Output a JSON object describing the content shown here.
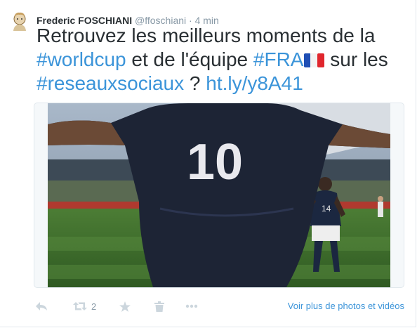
{
  "tweet": {
    "author_name": "Frederic FOSCHIANI",
    "handle": "@ffoschiani",
    "separator": "·",
    "time": "4 min",
    "text_part1": "Retrouvez les meilleurs moments de la ",
    "hashtag_worldcup": "#worldcup",
    "text_part2": " et de l'équipe ",
    "hashtag_fra": "#FRA",
    "text_part3": " sur les ",
    "hashtag_reseaux": "#reseauxsociaux",
    "text_part4": " ? ",
    "link": "ht.ly/y8A41"
  },
  "media": {
    "jersey_number": "10",
    "player2_number": "14"
  },
  "actions": {
    "reply_icon": "reply-icon",
    "retweet_icon": "retweet-icon",
    "retweet_count": "2",
    "favorite_icon": "star-icon",
    "delete_icon": "trash-icon",
    "more_icon": "more-dots-icon",
    "more_media_link": "Voir plus de photos et vidéos"
  },
  "colors": {
    "link": "#3b94d9",
    "muted": "#8899a6",
    "text": "#292f33",
    "action_icon": "#ccd6dd"
  }
}
